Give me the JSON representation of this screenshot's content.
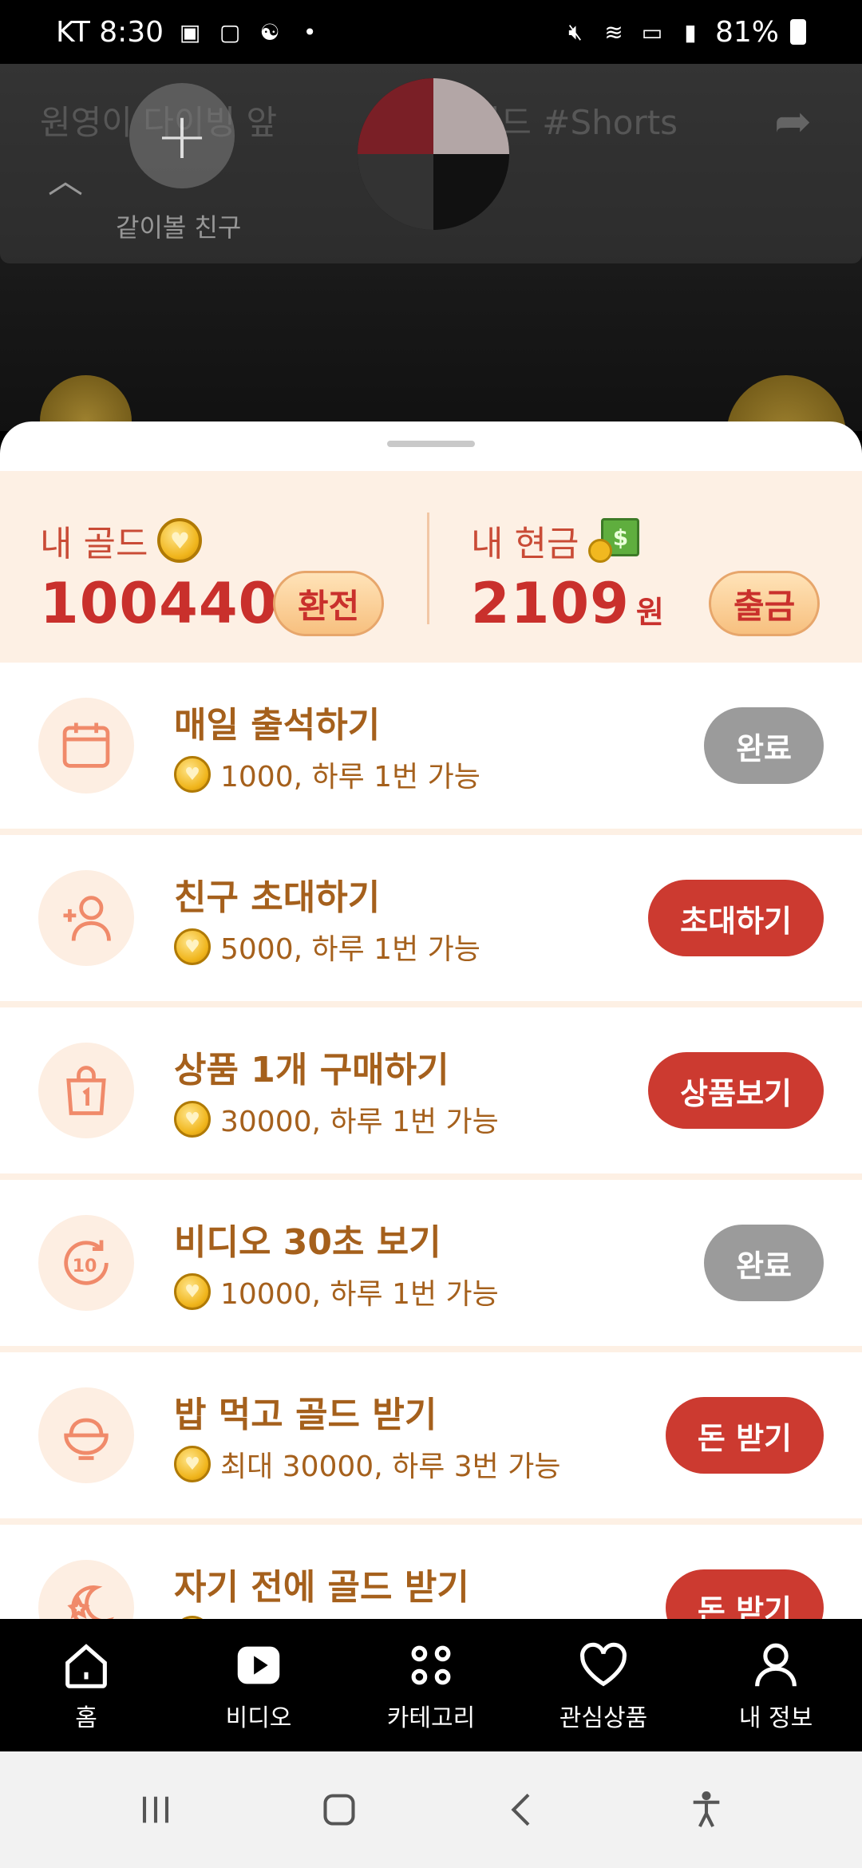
{
  "status_bar": {
    "carrier_time": "KT 8:30",
    "battery": "81%"
  },
  "video": {
    "title_left": "원영이 다이빙 앞",
    "title_right": "하인드 #Shorts",
    "add_friend_label": "같이볼 친구"
  },
  "wallet": {
    "gold_label": "내 골드",
    "gold_value": "100440",
    "exchange_button": "환전",
    "cash_label": "내 현금",
    "cash_value": "2109",
    "cash_unit": "원",
    "withdraw_button": "출금"
  },
  "tasks": [
    {
      "title": "매일 출석하기",
      "reward": "1000, 하루 1번 가능",
      "button": "완료",
      "state": "done",
      "icon": "calendar-icon"
    },
    {
      "title": "친구 초대하기",
      "reward": "5000, 하루 1번 가능",
      "button": "초대하기",
      "state": "active",
      "icon": "add-user-icon"
    },
    {
      "title": "상품 1개 구매하기",
      "reward": "30000, 하루 1번 가능",
      "button": "상품보기",
      "state": "active",
      "icon": "shopping-bag-icon"
    },
    {
      "title": "비디오 30초 보기",
      "reward": "10000, 하루 1번 가능",
      "button": "완료",
      "state": "done",
      "icon": "timer-10-icon"
    },
    {
      "title": "밥 먹고 골드 받기",
      "reward": "최대 30000, 하루 3번 가능",
      "button": "돈 받기",
      "state": "active",
      "icon": "rice-bowl-icon"
    },
    {
      "title": "자기 전에 골드 받기",
      "reward": "",
      "button": "돈 받기",
      "state": "active",
      "icon": "moon-star-icon"
    }
  ],
  "bottom_nav": {
    "home": "홈",
    "video": "비디오",
    "category": "카테고리",
    "favorites": "관심상품",
    "my_info": "내 정보"
  },
  "colors": {
    "accent_red": "#cc3a30",
    "gold_text": "#a5601c",
    "wallet_bg": "#fdf0e4",
    "done_gray": "#9b9b9b"
  }
}
